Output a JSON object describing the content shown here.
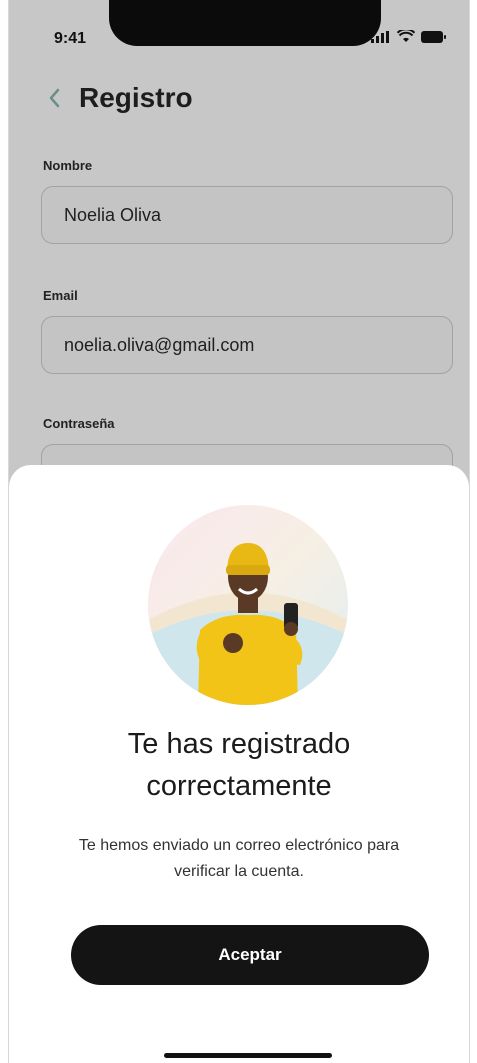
{
  "status_bar": {
    "time": "9:41",
    "icons": [
      "signal-icon",
      "wifi-icon",
      "battery-icon"
    ]
  },
  "header": {
    "back_icon": "chevron-left-icon",
    "title": "Registro"
  },
  "form": {
    "name": {
      "label": "Nombre",
      "value": "Noelia Oliva"
    },
    "email": {
      "label": "Email",
      "value": "noelia.oliva@gmail.com"
    },
    "password": {
      "label": "Contraseña",
      "value": ""
    }
  },
  "modal": {
    "illustration": "celebrating-person",
    "title": "Te has registrado correctamente",
    "message": "Te hemos enviado un correo electrónico para verificar la cuenta.",
    "button_label": "Aceptar"
  },
  "colors": {
    "accent": "#6b8f8a",
    "button": "#141414",
    "overlay_bg": "#c7c7c7"
  }
}
